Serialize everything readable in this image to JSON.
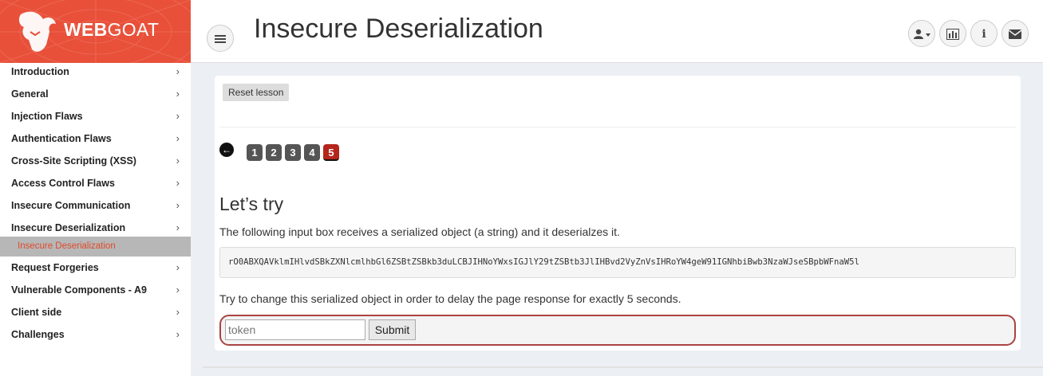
{
  "logo": {
    "web": "WEB",
    "goat": "GOAT"
  },
  "header": {
    "menu_icon": "hamburger-icon",
    "title": "Insecure Deserialization",
    "buttons": [
      {
        "icon": "user-dropdown-icon",
        "glyph": "👤▾"
      },
      {
        "icon": "chart-icon",
        "glyph": "▥"
      },
      {
        "icon": "info-icon",
        "glyph": "i"
      },
      {
        "icon": "envelope-icon",
        "glyph": "✉"
      }
    ]
  },
  "sidebar": {
    "items": [
      {
        "label": "Introduction"
      },
      {
        "label": "General"
      },
      {
        "label": "Injection Flaws"
      },
      {
        "label": "Authentication Flaws"
      },
      {
        "label": "Cross-Site Scripting (XSS)"
      },
      {
        "label": "Access Control Flaws"
      },
      {
        "label": "Insecure Communication"
      },
      {
        "label": "Insecure Deserialization"
      },
      {
        "label": "Request Forgeries"
      },
      {
        "label": "Vulnerable Components - A9"
      },
      {
        "label": "Client side"
      },
      {
        "label": "Challenges"
      }
    ],
    "active_sub": "Insecure Deserialization",
    "chevron": "›"
  },
  "lesson": {
    "reset_label": "Reset lesson",
    "back_arrow": "←",
    "pages": [
      "1",
      "2",
      "3",
      "4",
      "5"
    ],
    "active_page": "5",
    "heading": "Let’s try",
    "description": "The following input box receives a serialized object (a string) and it deserialzes it.",
    "serialized": "rO0ABXQAVklmIHlvdSBkZXNlcmlhbGl6ZSBtZSBkb3duLCBJIHNoYWxsIGJlY29tZSBtb3JlIHBvd2VyZnVsIHRoYW4geW91IGNhbiBwb3NzaWJseSBpbWFnaW5l",
    "instruction": "Try to change this serialized object in order to delay the page response for exactly 5 seconds.",
    "input_placeholder": "token",
    "input_value": "",
    "submit_label": "Submit"
  },
  "colors": {
    "accent": "#e8503a",
    "active_page": "#b4251b",
    "form_border": "#a94442",
    "active_sub_text": "#e04a2b"
  }
}
